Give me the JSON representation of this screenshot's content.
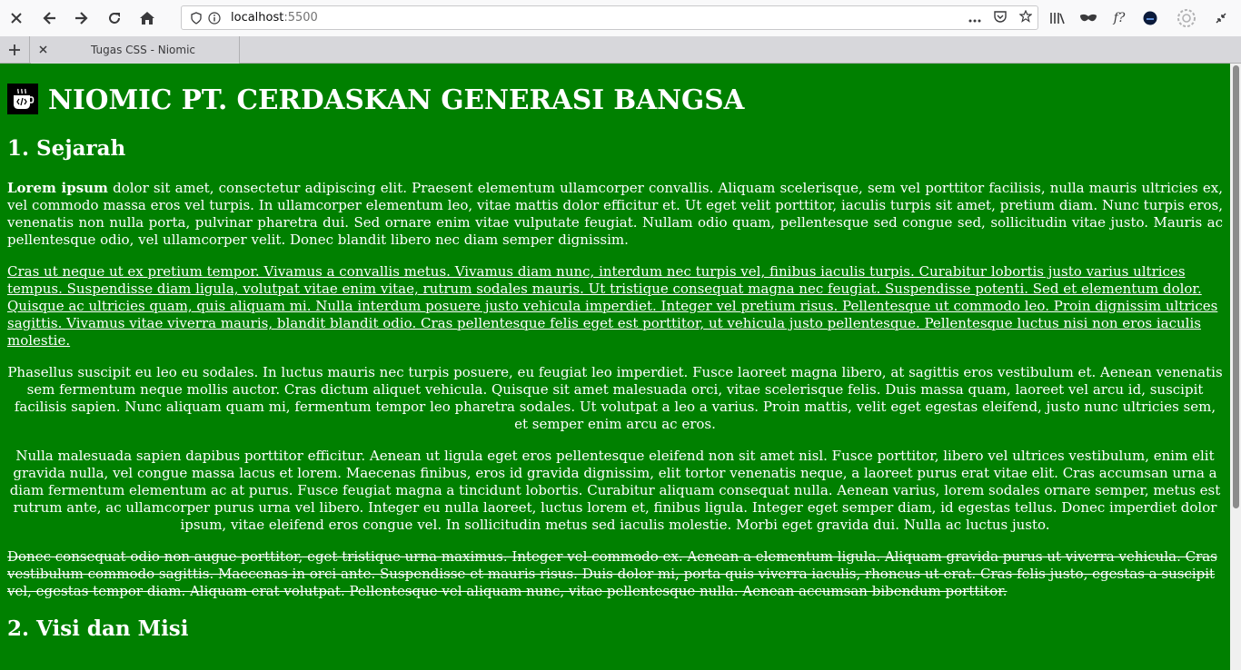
{
  "browser": {
    "url_host": "localhost",
    "url_port": ":5500",
    "tab_title": "Tugas CSS - Niomic",
    "toolbar_fx_label": "f?"
  },
  "page": {
    "main_title": "NIOMIC PT. CERDASKAN GENERASI BANGSA",
    "section1_heading": "1. Sejarah",
    "p1_bold": "Lorem ipsum",
    "p1_rest": " dolor sit amet, consectetur adipiscing elit. Praesent elementum ullamcorper convallis. Aliquam scelerisque, sem vel porttitor facilisis, nulla mauris ultricies ex, vel commodo massa eros vel turpis. In ullamcorper elementum leo, vitae mattis dolor efficitur et. Ut eget velit porttitor, iaculis turpis sit amet, pretium diam. Nunc turpis eros, venenatis non nulla porta, pulvinar pharetra dui. Sed ornare enim vitae vulputate feugiat. Nullam odio quam, pellentesque sed congue sed, sollicitudin vitae justo. Mauris ac pellentesque odio, vel ullamcorper velit. Donec blandit libero nec diam semper dignissim.",
    "p2": "Cras ut neque ut ex pretium tempor. Vivamus a convallis metus. Vivamus diam nunc, interdum nec turpis vel, finibus iaculis turpis. Curabitur lobortis justo varius ultrices tempus. Suspendisse diam ligula, volutpat vitae enim vitae, rutrum sodales mauris. Ut tristique consequat magna nec feugiat. Suspendisse potenti. Sed et elementum dolor. Quisque ac ultricies quam, quis aliquam mi. Nulla interdum posuere justo vehicula imperdiet. Integer vel pretium risus. Pellentesque ut commodo leo. Proin dignissim ultrices sagittis. Vivamus vitae viverra mauris, blandit blandit odio. Cras pellentesque felis eget est porttitor, ut vehicula justo pellentesque. Pellentesque luctus nisi non eros iaculis molestie.",
    "p3": "Phasellus suscipit eu leo eu sodales. In luctus mauris nec turpis posuere, eu feugiat leo imperdiet. Fusce laoreet magna libero, at sagittis eros vestibulum et. Aenean venenatis sem fermentum neque mollis auctor. Cras dictum aliquet vehicula. Quisque sit amet malesuada orci, vitae scelerisque felis. Duis massa quam, laoreet vel arcu id, suscipit facilisis sapien. Nunc aliquam quam mi, fermentum tempor leo pharetra sodales. Ut volutpat a leo a varius. Proin mattis, velit eget egestas eleifend, justo nunc ultricies sem, et semper enim arcu ac eros.",
    "p4": "Nulla malesuada sapien dapibus porttitor efficitur. Aenean ut ligula eget eros pellentesque eleifend non sit amet nisl. Fusce porttitor, libero vel ultrices vestibulum, enim elit gravida nulla, vel congue massa lacus et lorem. Maecenas finibus, eros id gravida dignissim, elit tortor venenatis neque, a laoreet purus erat vitae elit. Cras accumsan urna a diam fermentum elementum ac at purus. Fusce feugiat magna a tincidunt lobortis. Curabitur aliquam consequat nulla. Aenean varius, lorem sodales ornare semper, metus est rutrum ante, ac ullamcorper purus urna vel libero. Integer eu nulla laoreet, luctus lorem et, finibus ligula. Integer eget semper diam, id egestas tellus. Donec imperdiet dolor ipsum, vitae eleifend eros congue vel. In sollicitudin metus sed iaculis molestie. Morbi eget gravida dui. Nulla ac luctus justo.",
    "p5": "Donec consequat odio non augue porttitor, eget tristique urna maximus. Integer vel commodo ex. Aenean a elementum ligula. Aliquam gravida purus ut viverra vehicula. Cras vestibulum commodo sagittis. Maecenas in orci ante. Suspendisse et mauris risus. Duis dolor mi, porta quis viverra iaculis, rhoncus ut erat. Cras felis justo, egestas a suscipit vel, egestas tempor diam. Aliquam erat volutpat. Pellentesque vel aliquam nunc, vitae pellentesque nulla. Aenean accumsan bibendum porttitor.",
    "section2_heading": "2. Visi dan Misi"
  },
  "colors": {
    "page_background": "#008000",
    "text": "#ffffff"
  }
}
